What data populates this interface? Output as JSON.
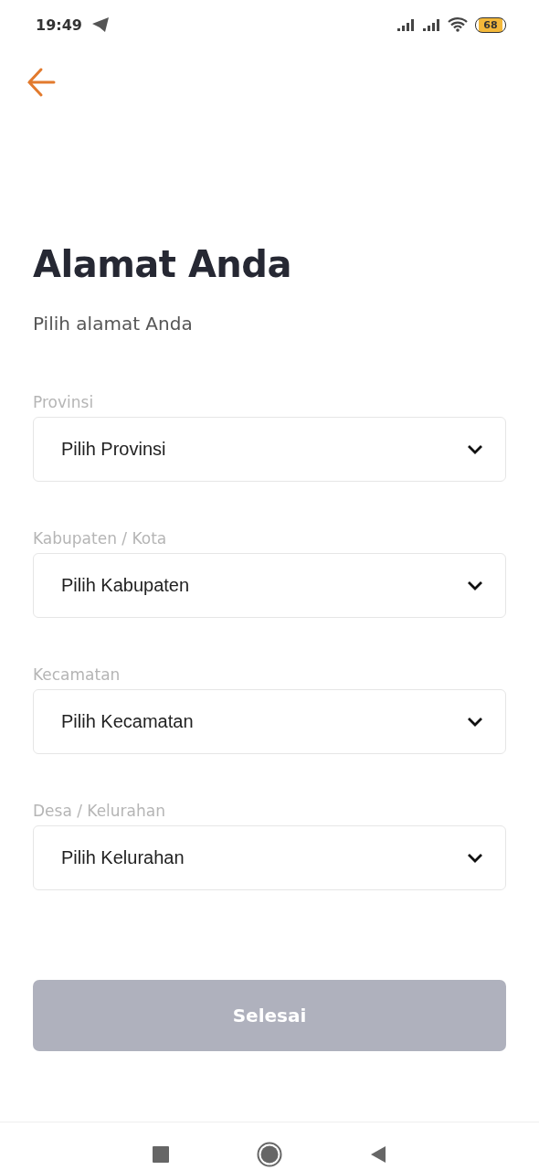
{
  "status_bar": {
    "time": "19:49",
    "battery": "68"
  },
  "header": {
    "title": "Alamat Anda",
    "subtitle": "Pilih alamat Anda"
  },
  "fields": [
    {
      "label": "Provinsi",
      "placeholder": "Pilih Provinsi"
    },
    {
      "label": "Kabupaten / Kota",
      "placeholder": "Pilih Kabupaten"
    },
    {
      "label": "Kecamatan",
      "placeholder": "Pilih Kecamatan"
    },
    {
      "label": "Desa / Kelurahan",
      "placeholder": "Pilih Kelurahan"
    }
  ],
  "submit": {
    "label": "Selesai",
    "disabled": true
  }
}
